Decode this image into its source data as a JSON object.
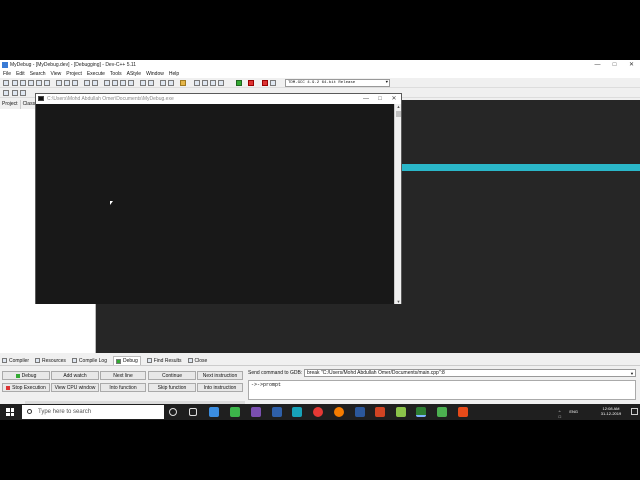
{
  "window": {
    "title": "MyDebug - [MyDebug.dev] - [Debugging] - Dev-C++ 5.11",
    "min": "—",
    "max": "□",
    "close": "✕"
  },
  "menu": [
    "File",
    "Edit",
    "Search",
    "View",
    "Project",
    "Execute",
    "Tools",
    "AStyle",
    "Window",
    "Help"
  ],
  "toolbar": {
    "compiler": "TDM-GCC 4.9.2 64-bit Release"
  },
  "left_panel": {
    "tabs": [
      "Project",
      "Class"
    ]
  },
  "console": {
    "title": "C:\\Users\\Mohd Abdullah Omer\\Documents\\MyDebug.exe",
    "min": "—",
    "max": "□",
    "close": "✕"
  },
  "bottom_tabs": [
    {
      "label": "Compiler",
      "icon": "grid-icon"
    },
    {
      "label": "Resources",
      "icon": "resources-icon"
    },
    {
      "label": "Compile Log",
      "icon": "log-icon"
    },
    {
      "label": "Debug",
      "icon": "check-icon",
      "active": true
    },
    {
      "label": "Find Results",
      "icon": "find-icon"
    },
    {
      "label": "Close",
      "icon": "close-icon"
    }
  ],
  "debug": {
    "buttons": {
      "debug": "Debug",
      "add_watch": "Add watch",
      "next_line": "Next line",
      "continue": "Continue",
      "next_instruction": "Next instruction",
      "stop_execution": "Stop Execution",
      "view_cpu": "View CPU window",
      "into_function": "Into function",
      "skip_function": "Skip function",
      "into_instruction": "Into instruction"
    },
    "gdb_label": "Send command to GDB:",
    "gdb_command": "break \"C:/Users/Mohd Abdullah Omer/Documents/main.cpp\":8",
    "gdb_output": "->->prompt"
  },
  "taskbar": {
    "search_placeholder": "Type here to search",
    "lang": "ENG",
    "time": "12:08 AM",
    "date": "31-12-2019",
    "sys_icons": "^ □ ♪"
  },
  "colors": {
    "editor_bg": "#262626",
    "highlight": "#2ab7c9",
    "console_bg": "#181818",
    "taskbar": "#1f1f1f"
  }
}
